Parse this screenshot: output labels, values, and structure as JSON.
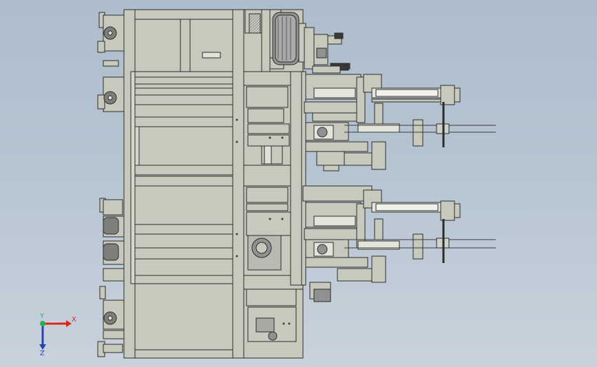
{
  "triad": {
    "x_label": "X",
    "y_label": "Y",
    "z_label": "Z",
    "x_color": "#d9261c",
    "y_color": "#22b24c",
    "z_color": "#2741b8"
  },
  "colors": {
    "background_top": "#aebdcc",
    "background_bottom": "#c9d2dc",
    "frame_fill": "#c8c9bd",
    "frame_stroke": "#2b2b2b",
    "motor_fill": "#8f9291",
    "rod_dark": "#3a3a3a"
  }
}
